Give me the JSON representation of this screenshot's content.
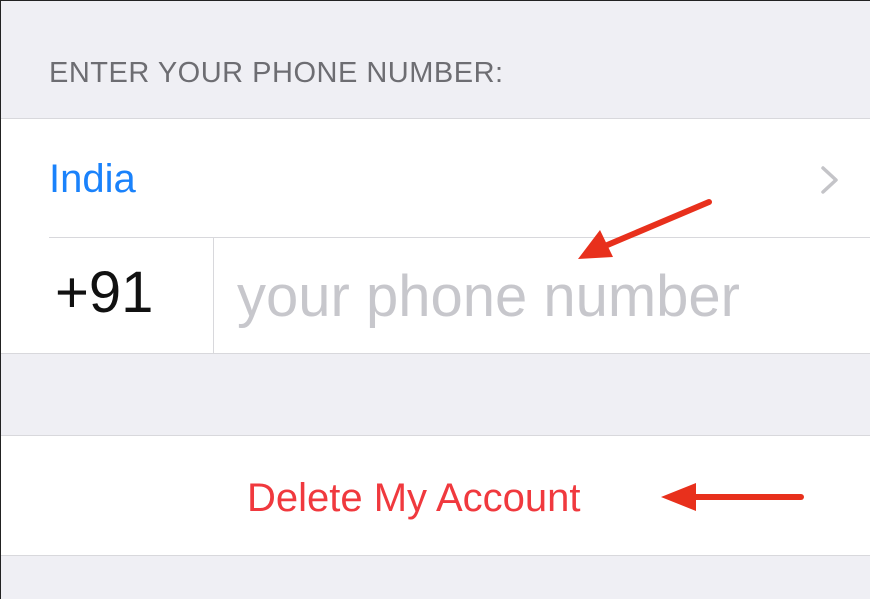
{
  "section": {
    "header": "ENTER YOUR PHONE NUMBER:"
  },
  "country": {
    "label": "India"
  },
  "phone": {
    "code": "+91",
    "placeholder": "your phone number",
    "value": ""
  },
  "actions": {
    "delete_label": "Delete My Account"
  },
  "colors": {
    "link_blue": "#1a82fb",
    "destructive_red": "#f0393e",
    "annotation_arrow": "#e8301c",
    "grouped_background": "#efeff4"
  },
  "icons": {
    "country_chevron": "chevron-right-icon",
    "annotation_arrows": "arrow-annotation-icon"
  }
}
